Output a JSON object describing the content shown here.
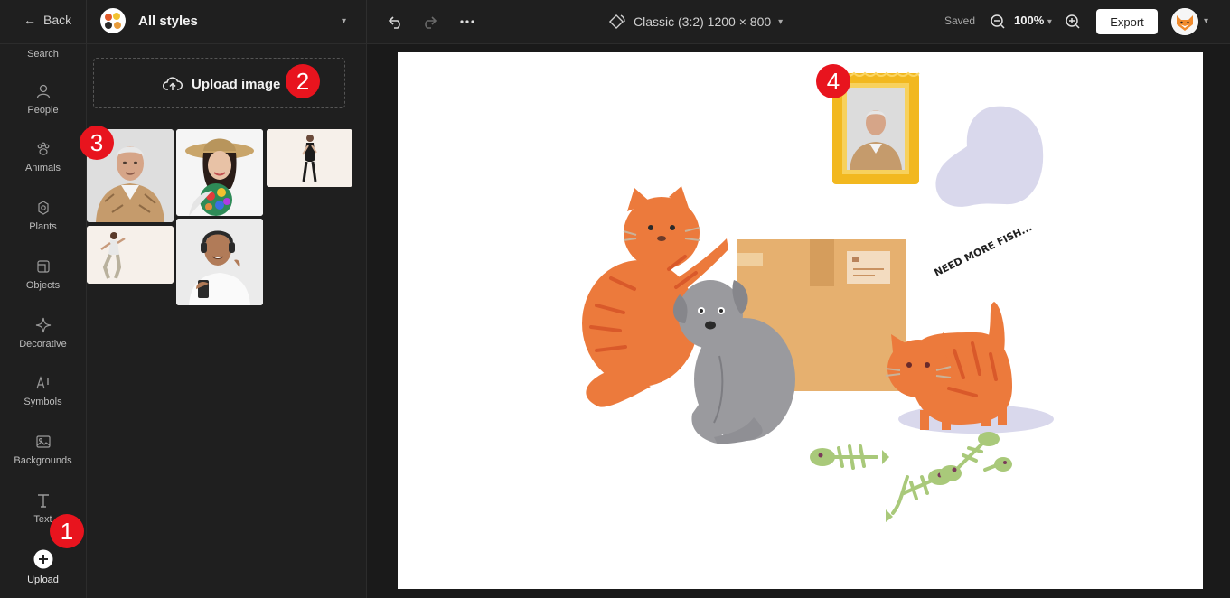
{
  "topbar": {
    "back_label": "Back",
    "style_label": "All styles",
    "canvas_size": "Classic  (3:2) 1200 × 800",
    "saved_label": "Saved",
    "zoom_label": "100%",
    "export_label": "Export"
  },
  "sidebar": {
    "items": [
      {
        "label": "Search"
      },
      {
        "label": "People"
      },
      {
        "label": "Animals"
      },
      {
        "label": "Plants"
      },
      {
        "label": "Objects"
      },
      {
        "label": "Decorative"
      },
      {
        "label": "Symbols"
      },
      {
        "label": "Backgrounds"
      },
      {
        "label": "Text"
      },
      {
        "label": "Upload"
      }
    ]
  },
  "panel": {
    "upload_label": "Upload image"
  },
  "canvas": {
    "speech_text": "NEED MORE FISH..."
  },
  "badges": [
    "1",
    "2",
    "3",
    "4"
  ],
  "colors": {
    "accent_badge": "#e8141e",
    "frame_gold": "#f2b81f",
    "cat_orange": "#ec7a3c",
    "dog_gray": "#9a9a9e",
    "box_tan": "#e6b06f",
    "fish_green": "#a9c97a"
  }
}
